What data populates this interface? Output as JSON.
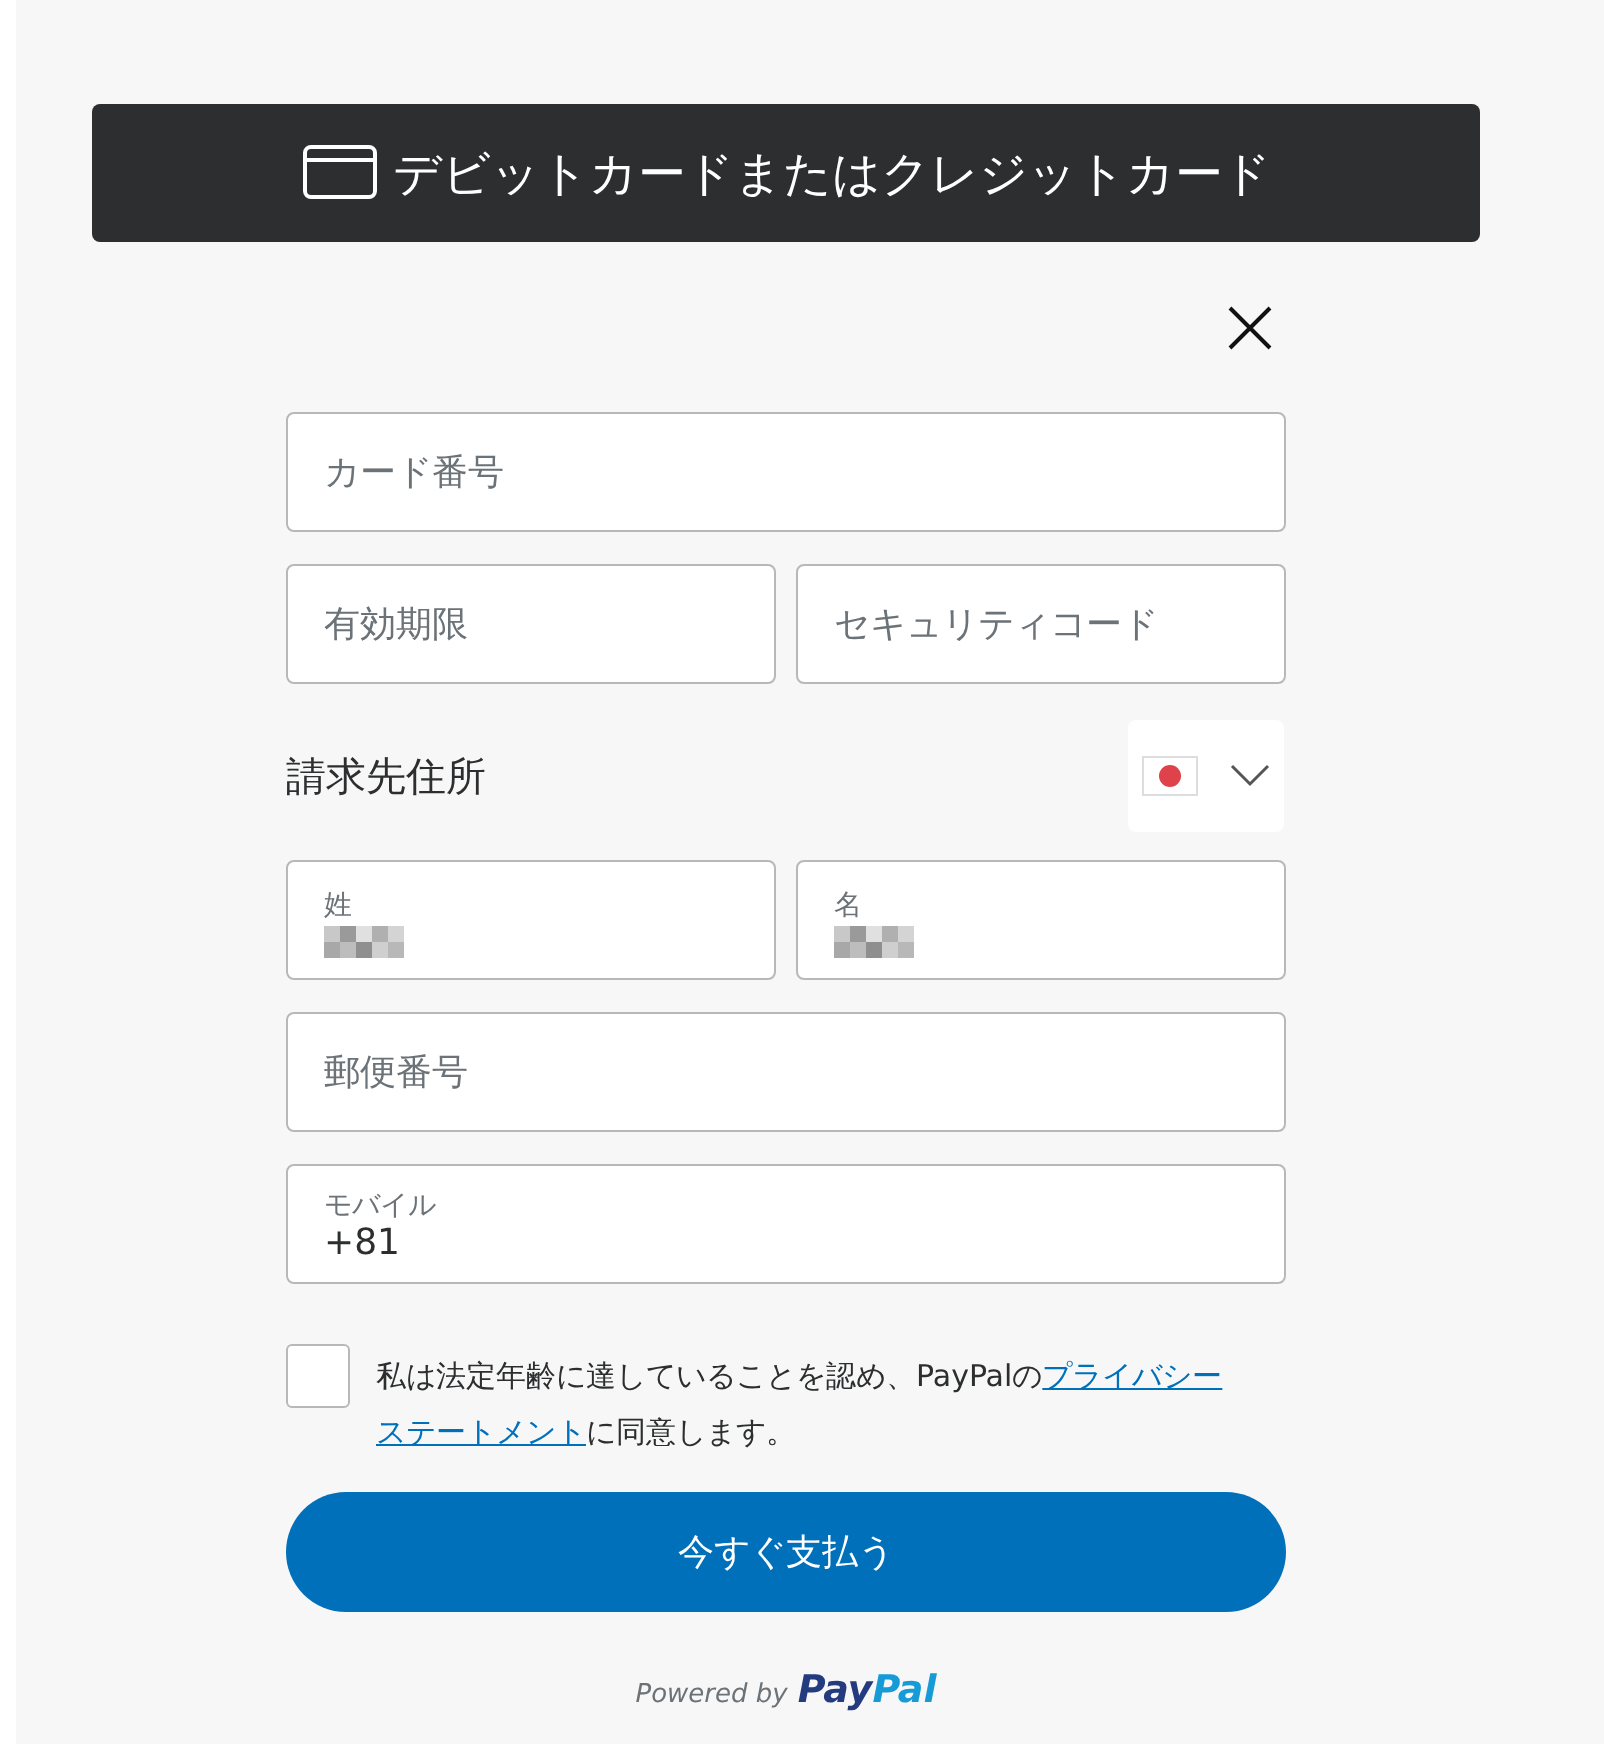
{
  "header": {
    "title": "デビットカードまたはクレジットカード"
  },
  "card_fields": [
    {
      "placeholder": "カード番号"
    },
    {
      "placeholder": "有効期限"
    },
    {
      "placeholder": "セキュリティコード"
    }
  ],
  "billing": {
    "heading": "請求先住所",
    "name_fields": [
      {
        "label": "姓",
        "redacted": true
      },
      {
        "label": "名",
        "redacted": true
      }
    ],
    "postal": {
      "placeholder": "郵便番号"
    },
    "mobile": {
      "label": "モバイル",
      "value": "+81"
    }
  },
  "agreement": {
    "checked": false,
    "parts": [
      {
        "kind": "text",
        "text": "私は法定年齢に達していることを認め、PayPalの"
      },
      {
        "kind": "link",
        "text": "プライバシー"
      },
      {
        "kind": "link",
        "text": "ステートメント"
      },
      {
        "kind": "text",
        "text": "に同意します。"
      }
    ]
  },
  "pay_button": "今すぐ支払う",
  "footer": {
    "powered_by": "Powered by",
    "logo_parts": [
      "Pay",
      "Pal"
    ]
  }
}
